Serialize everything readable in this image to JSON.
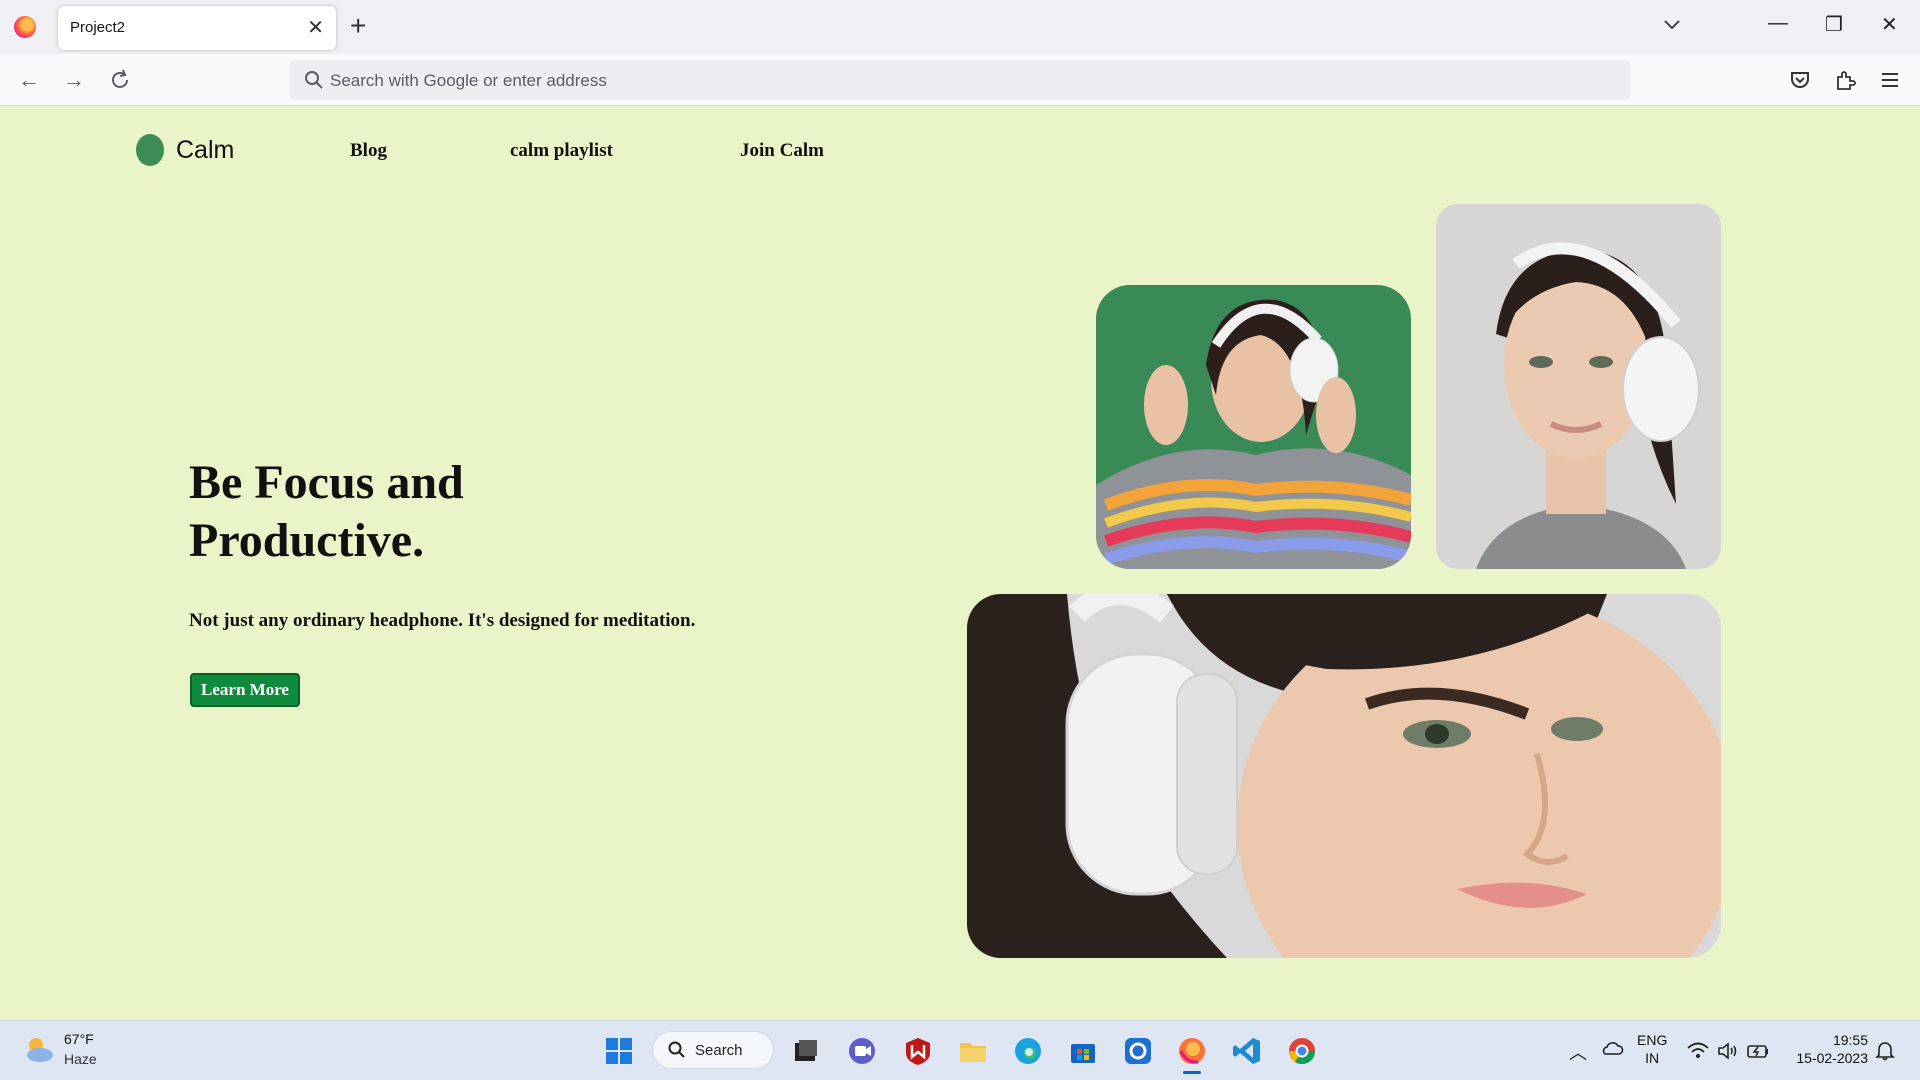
{
  "browser": {
    "tab_title": "Project2",
    "tab_close": "✕",
    "new_tab": "+",
    "url_placeholder": "Search with Google or enter address",
    "controls": {
      "minimize": "—",
      "restore": "❐",
      "close": "✕"
    }
  },
  "site": {
    "brand": "Calm",
    "nav": [
      "Blog",
      "calm playlist",
      "Join Calm"
    ],
    "hero": {
      "title_line1": "Be Focus and",
      "title_line2": "Productive.",
      "subtitle": "Not just any ordinary headphone. It's designed for meditation.",
      "cta": "Learn More"
    },
    "colors": {
      "background": "#eaf4c9",
      "brand_green": "#3d8c55",
      "button_green": "#108a3c"
    }
  },
  "taskbar": {
    "weather_temp": "67°F",
    "weather_condition": "Haze",
    "search_label": "Search",
    "language": "ENG",
    "region": "IN",
    "time": "19:55",
    "date": "15-02-2023"
  }
}
